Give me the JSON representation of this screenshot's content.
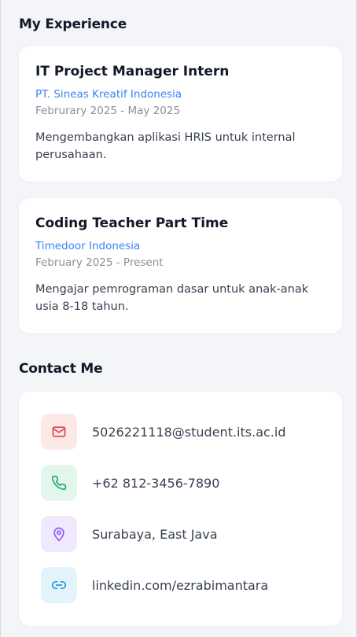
{
  "experience": {
    "heading": "My Experience",
    "items": [
      {
        "title": "IT Project Manager Intern",
        "company": "PT. Sineas Kreatif Indonesia",
        "period": "Februrary 2025 - May 2025",
        "description": "Mengembangkan aplikasi HRIS untuk internal perusahaan."
      },
      {
        "title": "Coding Teacher Part Time",
        "company": "Timedoor Indonesia",
        "period": "February 2025 - Present",
        "description": "Mengajar pemrograman dasar untuk anak-anak usia 8-18 tahun."
      }
    ]
  },
  "contact": {
    "heading": "Contact Me",
    "items": [
      {
        "icon": "mail-icon",
        "value": "5026221118@student.its.ac.id",
        "bg": "#fde8e8",
        "fg": "#e0404a"
      },
      {
        "icon": "phone-icon",
        "value": "+62 812-3456-7890",
        "bg": "#e3f6ec",
        "fg": "#22a86b"
      },
      {
        "icon": "location-pin-icon",
        "value": "Surabaya, East Java",
        "bg": "#f0e9fd",
        "fg": "#8b5cf6"
      },
      {
        "icon": "link-icon",
        "value": "linkedin.com/ezrabimantara",
        "bg": "#e3f3fc",
        "fg": "#1e9ad6"
      }
    ]
  },
  "colors": {
    "accent": "#3b82f6",
    "background": "#f4f5f9",
    "card": "#ffffff"
  }
}
